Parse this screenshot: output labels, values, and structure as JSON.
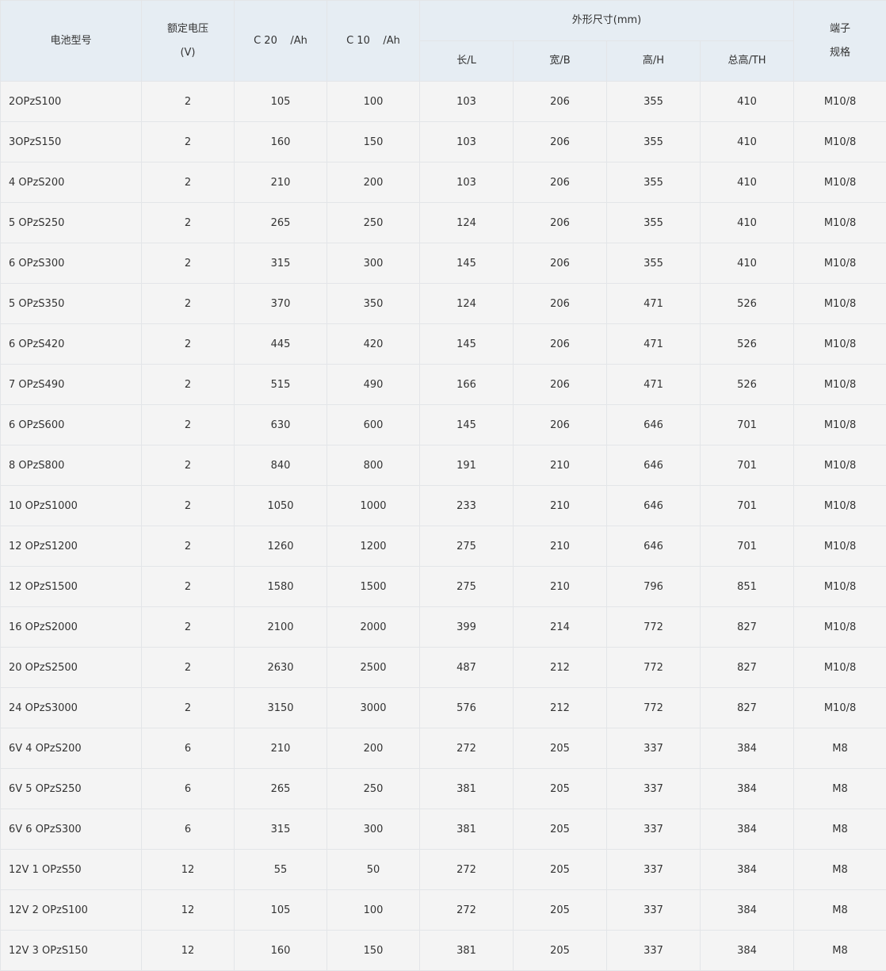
{
  "header": {
    "model": "电池型号",
    "voltage_line1": "额定电压",
    "voltage_line2": "(V)",
    "c20": "C 20    /Ah",
    "c10": "C 10    /Ah",
    "dimensions": "外形尺寸(mm)",
    "length": "长/L",
    "width": "宽/B",
    "height": "高/H",
    "total_height": "总高/TH",
    "terminal_line1": "端子",
    "terminal_line2": "规格"
  },
  "rows": [
    [
      "2OPzS100",
      "2",
      "105",
      "100",
      "103",
      "206",
      "355",
      "410",
      "M10/8"
    ],
    [
      "3OPzS150",
      "2",
      "160",
      "150",
      "103",
      "206",
      "355",
      "410",
      "M10/8"
    ],
    [
      "4 OPzS200",
      "2",
      "210",
      "200",
      "103",
      "206",
      "355",
      "410",
      "M10/8"
    ],
    [
      "5 OPzS250",
      "2",
      "265",
      "250",
      "124",
      "206",
      "355",
      "410",
      "M10/8"
    ],
    [
      "6 OPzS300",
      "2",
      "315",
      "300",
      "145",
      "206",
      "355",
      "410",
      "M10/8"
    ],
    [
      "5 OPzS350",
      "2",
      "370",
      "350",
      "124",
      "206",
      "471",
      "526",
      "M10/8"
    ],
    [
      "6 OPzS420",
      "2",
      "445",
      "420",
      "145",
      "206",
      "471",
      "526",
      "M10/8"
    ],
    [
      "7 OPzS490",
      "2",
      "515",
      "490",
      "166",
      "206",
      "471",
      "526",
      "M10/8"
    ],
    [
      "6 OPzS600",
      "2",
      "630",
      "600",
      "145",
      "206",
      "646",
      "701",
      "M10/8"
    ],
    [
      "8 OPzS800",
      "2",
      "840",
      "800",
      "191",
      "210",
      "646",
      "701",
      "M10/8"
    ],
    [
      "10 OPzS1000",
      "2",
      "1050",
      "1000",
      "233",
      "210",
      "646",
      "701",
      "M10/8"
    ],
    [
      "12 OPzS1200",
      "2",
      "1260",
      "1200",
      "275",
      "210",
      "646",
      "701",
      "M10/8"
    ],
    [
      "12 OPzS1500",
      "2",
      "1580",
      "1500",
      "275",
      "210",
      "796",
      "851",
      "M10/8"
    ],
    [
      "16 OPzS2000",
      "2",
      "2100",
      "2000",
      "399",
      "214",
      "772",
      "827",
      "M10/8"
    ],
    [
      "20 OPzS2500",
      "2",
      "2630",
      "2500",
      "487",
      "212",
      "772",
      "827",
      "M10/8"
    ],
    [
      "24 OPzS3000",
      "2",
      "3150",
      "3000",
      "576",
      "212",
      "772",
      "827",
      "M10/8"
    ],
    [
      "6V 4 OPzS200",
      "6",
      "210",
      "200",
      "272",
      "205",
      "337",
      "384",
      "M8"
    ],
    [
      "6V 5 OPzS250",
      "6",
      "265",
      "250",
      "381",
      "205",
      "337",
      "384",
      "M8"
    ],
    [
      "6V 6 OPzS300",
      "6",
      "315",
      "300",
      "381",
      "205",
      "337",
      "384",
      "M8"
    ],
    [
      "12V 1 OPzS50",
      "12",
      "55",
      "50",
      "272",
      "205",
      "337",
      "384",
      "M8"
    ],
    [
      "12V 2 OPzS100",
      "12",
      "105",
      "100",
      "272",
      "205",
      "337",
      "384",
      "M8"
    ],
    [
      "12V 3 OPzS150",
      "12",
      "160",
      "150",
      "381",
      "205",
      "337",
      "384",
      "M8"
    ]
  ]
}
